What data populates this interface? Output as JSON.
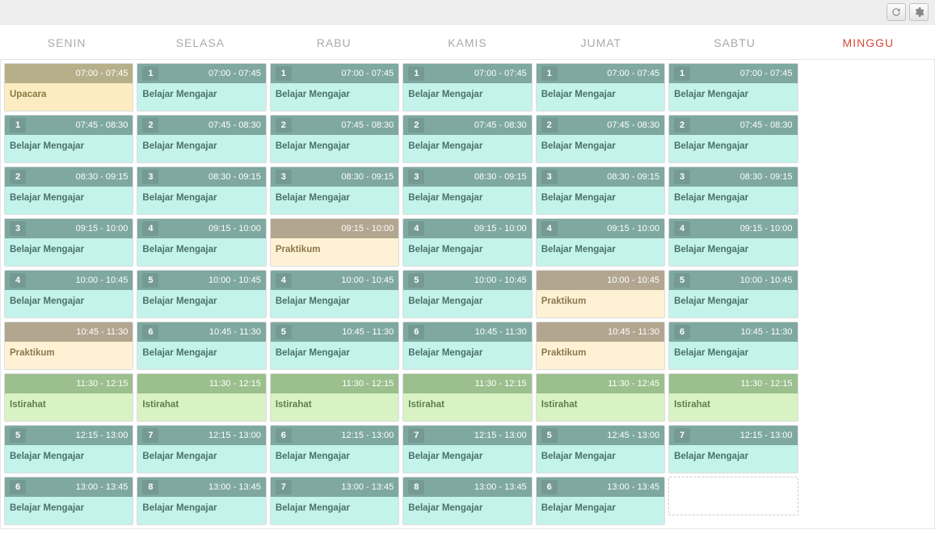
{
  "days": [
    "SENIN",
    "SELASA",
    "RABU",
    "KAMIS",
    "JUMAT",
    "SABTU",
    "MINGGU"
  ],
  "labels": {
    "belajar": "Belajar Mengajar",
    "praktikum": "Praktikum",
    "istirahat": "Istirahat",
    "upacara": "Upacara"
  },
  "columns": [
    {
      "slots": [
        {
          "num": "",
          "time": "07:00 - 07:45",
          "type": "olive",
          "label": "upacara"
        },
        {
          "num": "1",
          "time": "07:45 - 08:30",
          "type": "teal",
          "label": "belajar"
        },
        {
          "num": "2",
          "time": "08:30 - 09:15",
          "type": "teal",
          "label": "belajar"
        },
        {
          "num": "3",
          "time": "09:15 - 10:00",
          "type": "teal",
          "label": "belajar"
        },
        {
          "num": "4",
          "time": "10:00 - 10:45",
          "type": "teal",
          "label": "belajar"
        },
        {
          "num": "",
          "time": "10:45 - 11:30",
          "type": "tan",
          "label": "praktikum"
        },
        {
          "num": "",
          "time": "11:30 - 12:15",
          "type": "green",
          "label": "istirahat"
        },
        {
          "num": "5",
          "time": "12:15 - 13:00",
          "type": "teal",
          "label": "belajar"
        },
        {
          "num": "6",
          "time": "13:00 - 13:45",
          "type": "teal",
          "label": "belajar"
        }
      ]
    },
    {
      "slots": [
        {
          "num": "1",
          "time": "07:00 - 07:45",
          "type": "teal",
          "label": "belajar"
        },
        {
          "num": "2",
          "time": "07:45 - 08:30",
          "type": "teal",
          "label": "belajar"
        },
        {
          "num": "3",
          "time": "08:30 - 09:15",
          "type": "teal",
          "label": "belajar"
        },
        {
          "num": "4",
          "time": "09:15 - 10:00",
          "type": "teal",
          "label": "belajar"
        },
        {
          "num": "5",
          "time": "10:00 - 10:45",
          "type": "teal",
          "label": "belajar"
        },
        {
          "num": "6",
          "time": "10:45 - 11:30",
          "type": "teal",
          "label": "belajar"
        },
        {
          "num": "",
          "time": "11:30 - 12:15",
          "type": "green",
          "label": "istirahat"
        },
        {
          "num": "7",
          "time": "12:15 - 13:00",
          "type": "teal",
          "label": "belajar"
        },
        {
          "num": "8",
          "time": "13:00 - 13:45",
          "type": "teal",
          "label": "belajar"
        }
      ]
    },
    {
      "slots": [
        {
          "num": "1",
          "time": "07:00 - 07:45",
          "type": "teal",
          "label": "belajar"
        },
        {
          "num": "2",
          "time": "07:45 - 08:30",
          "type": "teal",
          "label": "belajar"
        },
        {
          "num": "3",
          "time": "08:30 - 09:15",
          "type": "teal",
          "label": "belajar"
        },
        {
          "num": "",
          "time": "09:15 - 10:00",
          "type": "tan",
          "label": "praktikum"
        },
        {
          "num": "4",
          "time": "10:00 - 10:45",
          "type": "teal",
          "label": "belajar"
        },
        {
          "num": "5",
          "time": "10:45 - 11:30",
          "type": "teal",
          "label": "belajar"
        },
        {
          "num": "",
          "time": "11:30 - 12:15",
          "type": "green",
          "label": "istirahat"
        },
        {
          "num": "6",
          "time": "12:15 - 13:00",
          "type": "teal",
          "label": "belajar"
        },
        {
          "num": "7",
          "time": "13:00 - 13:45",
          "type": "teal",
          "label": "belajar"
        }
      ]
    },
    {
      "slots": [
        {
          "num": "1",
          "time": "07:00 - 07:45",
          "type": "teal",
          "label": "belajar"
        },
        {
          "num": "2",
          "time": "07:45 - 08:30",
          "type": "teal",
          "label": "belajar"
        },
        {
          "num": "3",
          "time": "08:30 - 09:15",
          "type": "teal",
          "label": "belajar"
        },
        {
          "num": "4",
          "time": "09:15 - 10:00",
          "type": "teal",
          "label": "belajar"
        },
        {
          "num": "5",
          "time": "10:00 - 10:45",
          "type": "teal",
          "label": "belajar"
        },
        {
          "num": "6",
          "time": "10:45 - 11:30",
          "type": "teal",
          "label": "belajar"
        },
        {
          "num": "",
          "time": "11:30 - 12:15",
          "type": "green",
          "label": "istirahat"
        },
        {
          "num": "7",
          "time": "12:15 - 13:00",
          "type": "teal",
          "label": "belajar"
        },
        {
          "num": "8",
          "time": "13:00 - 13:45",
          "type": "teal",
          "label": "belajar"
        }
      ]
    },
    {
      "slots": [
        {
          "num": "1",
          "time": "07:00 - 07:45",
          "type": "teal",
          "label": "belajar"
        },
        {
          "num": "2",
          "time": "07:45 - 08:30",
          "type": "teal",
          "label": "belajar"
        },
        {
          "num": "3",
          "time": "08:30 - 09:15",
          "type": "teal",
          "label": "belajar"
        },
        {
          "num": "4",
          "time": "09:15 - 10:00",
          "type": "teal",
          "label": "belajar"
        },
        {
          "num": "",
          "time": "10:00 - 10:45",
          "type": "tan",
          "label": "praktikum"
        },
        {
          "num": "",
          "time": "10:45 - 11:30",
          "type": "tan",
          "label": "praktikum"
        },
        {
          "num": "",
          "time": "11:30 - 12:45",
          "type": "green",
          "label": "istirahat"
        },
        {
          "num": "5",
          "time": "12:45 - 13:00",
          "type": "teal",
          "label": "belajar"
        },
        {
          "num": "6",
          "time": "13:00 - 13:45",
          "type": "teal",
          "label": "belajar"
        }
      ]
    },
    {
      "slots": [
        {
          "num": "1",
          "time": "07:00 - 07:45",
          "type": "teal",
          "label": "belajar"
        },
        {
          "num": "2",
          "time": "07:45 - 08:30",
          "type": "teal",
          "label": "belajar"
        },
        {
          "num": "3",
          "time": "08:30 - 09:15",
          "type": "teal",
          "label": "belajar"
        },
        {
          "num": "4",
          "time": "09:15 - 10:00",
          "type": "teal",
          "label": "belajar"
        },
        {
          "num": "5",
          "time": "10:00 - 10:45",
          "type": "teal",
          "label": "belajar"
        },
        {
          "num": "6",
          "time": "10:45 - 11:30",
          "type": "teal",
          "label": "belajar"
        },
        {
          "num": "",
          "time": "11:30 - 12:15",
          "type": "green",
          "label": "istirahat"
        },
        {
          "num": "7",
          "time": "12:15 - 13:00",
          "type": "teal",
          "label": "belajar"
        },
        {
          "placeholder": true
        }
      ]
    },
    {
      "slots": []
    }
  ]
}
